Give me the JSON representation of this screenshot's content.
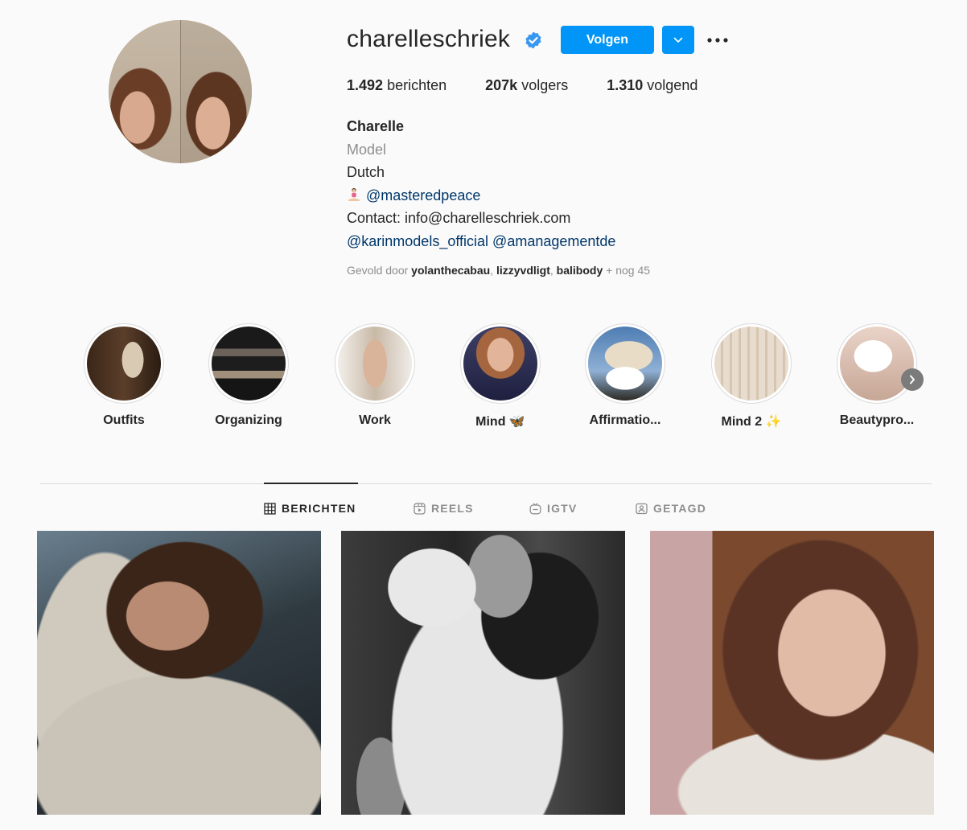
{
  "profile": {
    "username": "charelleschriek",
    "follow_label": "Volgen",
    "stats": {
      "posts_count": "1.492",
      "posts_label": "berichten",
      "followers_count": "207k",
      "followers_label": "volgers",
      "following_count": "1.310",
      "following_label": "volgend"
    },
    "bio": {
      "name": "Charelle",
      "category": "Model",
      "line1": "Dutch",
      "mention1": "@masteredpeace",
      "contact": "Contact: info@charelleschriek.com",
      "mention2": "@karinmodels_official",
      "mention3": "@amanagementde"
    },
    "followed_by": {
      "prefix": "Gevold door",
      "user1": "yolanthecabau",
      "user2": "lizzyvdligt",
      "user3": "balibody",
      "suffix": "+ nog 45"
    }
  },
  "highlights": [
    {
      "label": "Outfits"
    },
    {
      "label": "Organizing"
    },
    {
      "label": "Work"
    },
    {
      "label": "Mind 🦋"
    },
    {
      "label": "Affirmatio..."
    },
    {
      "label": "Mind 2 ✨"
    },
    {
      "label": "Beautypro..."
    }
  ],
  "tabs": {
    "posts": "BERICHTEN",
    "reels": "REELS",
    "igtv": "IGTV",
    "tagged": "GETAGD"
  },
  "colors": {
    "accent": "#0095f6",
    "link": "#00376b",
    "muted": "#8e8e8e",
    "verified": "#3897f0"
  }
}
